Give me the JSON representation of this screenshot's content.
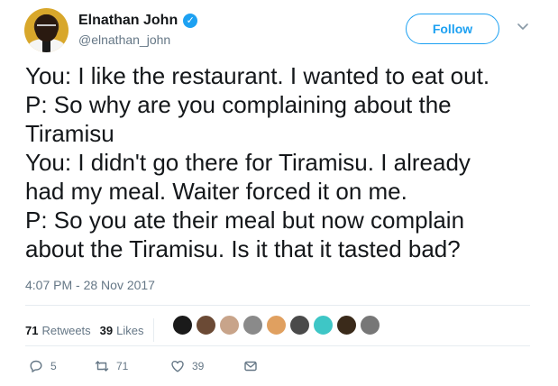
{
  "author": {
    "display_name": "Elnathan John",
    "handle": "@elnathan_john",
    "verified": true
  },
  "follow_label": "Follow",
  "tweet": {
    "lines": [
      "You: I like the restaurant. I wanted to eat out.",
      "P: So why are you complaining about the",
      "Tiramisu",
      "You: I didn't go there for Tiramisu. I already",
      "had my meal. Waiter forced it on me.",
      "P: So you ate their meal but now complain",
      "about the Tiramisu. Is it that it tasted bad?"
    ],
    "timestamp": "4:07 PM - 28 Nov 2017"
  },
  "stats": {
    "retweets_count": "71",
    "retweets_label": "Retweets",
    "likes_count": "39",
    "likes_label": "Likes"
  },
  "likers": [
    {
      "color": "#1a1a1a"
    },
    {
      "color": "#6b4a35"
    },
    {
      "color": "#c8a48a"
    },
    {
      "color": "#8a8a8a"
    },
    {
      "color": "#e0a060"
    },
    {
      "color": "#4a4a4a"
    },
    {
      "color": "#3ec6c6"
    },
    {
      "color": "#3a2a1a"
    },
    {
      "color": "#777777"
    }
  ],
  "actions": {
    "replies": "5",
    "retweets": "71",
    "likes": "39"
  },
  "colors": {
    "accent": "#1da1f2",
    "secondary_text": "#657786",
    "divider": "#e6ecf0"
  },
  "icons": [
    "verified-badge-icon",
    "chevron-down-icon",
    "reply-icon",
    "retweet-icon",
    "like-icon",
    "direct-message-icon"
  ]
}
